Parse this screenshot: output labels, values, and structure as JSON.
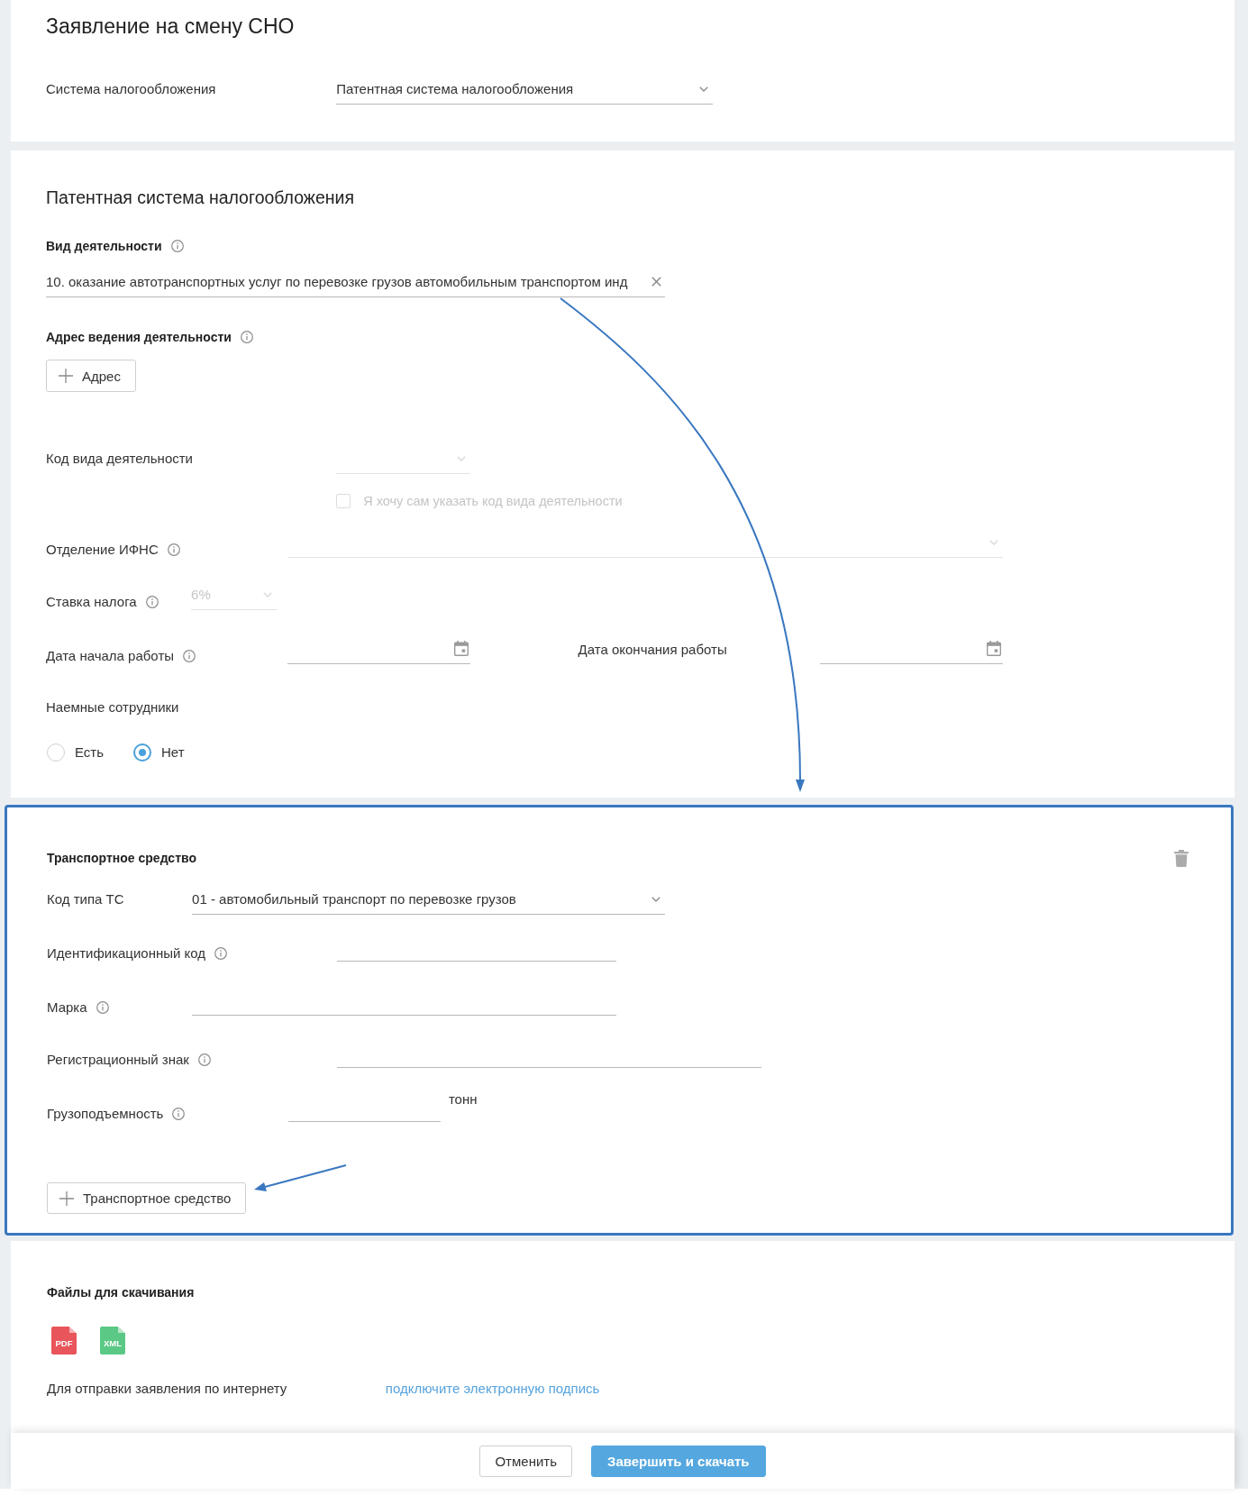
{
  "form": {
    "title": "Заявление на смену СНО",
    "tax_system": {
      "label": "Система налогообложения",
      "info": false,
      "value": "Патентная система налогообложения",
      "disabled": false
    }
  },
  "patent": {
    "title": "Патентная система налогообложения",
    "activity": {
      "label": "Вид деятельности",
      "info": true,
      "value": "10. оказание автотранспортных услуг по перевозке грузов автомобильным транспортом инд"
    },
    "address": {
      "label": "Адрес ведения деятельности",
      "info": true,
      "button": "Адрес"
    },
    "activity_code": {
      "label": "Код вида деятельности",
      "info": false,
      "disabled": true,
      "checkbox": {
        "label": "Я хочу сам указать код вида деятельности",
        "checked": false,
        "disabled": true
      }
    },
    "ifns": {
      "label": "Отделение ИФНС",
      "info": true,
      "disabled": true
    },
    "tax_rate": {
      "label": "Ставка налога",
      "info": true,
      "value": "6%",
      "disabled": true
    },
    "dates": [
      {
        "label": "Дата начала работы",
        "info": true
      },
      {
        "label": "Дата окончания работы",
        "info": false
      }
    ],
    "employees": {
      "label": "Наемные сотрудники",
      "options": [
        {
          "label": "Есть",
          "selected": false
        },
        {
          "label": "Нет",
          "selected": true
        }
      ]
    }
  },
  "vehicle": {
    "title": "Транспортное средство",
    "fields": [
      {
        "kind": "select",
        "label": "Код типа ТС",
        "info": false,
        "value": "01 - автомобильный транспорт по перевозке грузов",
        "disabled": false
      },
      {
        "kind": "text",
        "label": "Идентификационный код",
        "info": true
      },
      {
        "kind": "text",
        "label": "Марка",
        "info": true
      },
      {
        "kind": "text",
        "label": "Регистрационный знак",
        "info": true
      },
      {
        "kind": "text",
        "label": "Грузоподъемность",
        "info": true,
        "unit": "тонн"
      }
    ],
    "add_button": "Транспортное средство"
  },
  "files": {
    "title": "Файлы для скачивания",
    "items": [
      {
        "label": "PDF",
        "color": "#e8555a"
      },
      {
        "label": "XML",
        "color": "#5bc885"
      }
    ],
    "send_text": "Для отправки заявления по интернету",
    "link": "подключите электронную подпись"
  },
  "footer": {
    "buttons": [
      {
        "kind": "secondary",
        "label": "Отменить"
      },
      {
        "kind": "primary",
        "label": "Завершить и скачать"
      }
    ]
  }
}
